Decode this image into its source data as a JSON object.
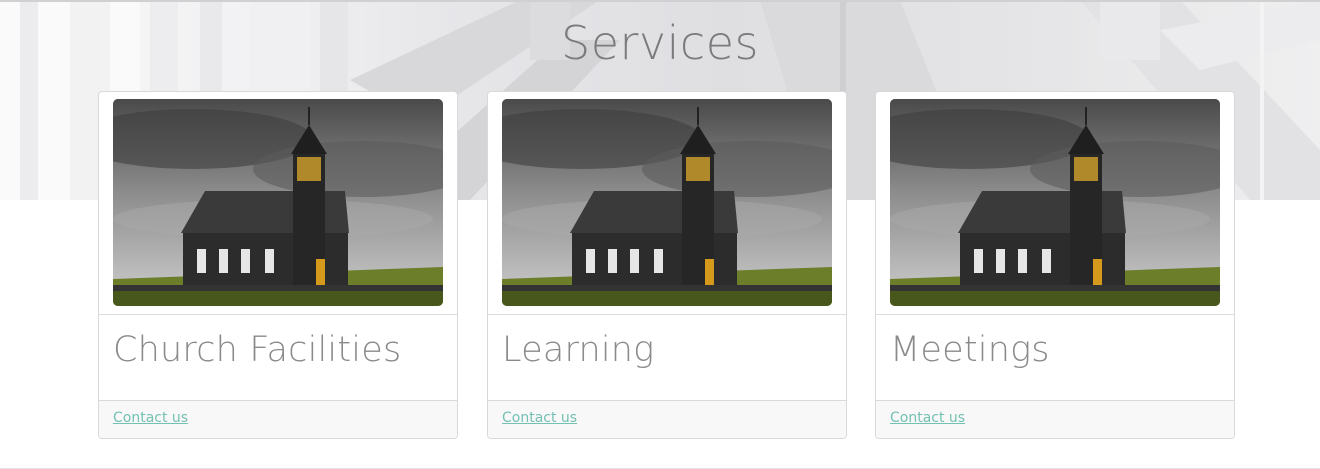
{
  "section": {
    "title": "Services"
  },
  "cards": [
    {
      "title": "Church Facilities",
      "link": "Contact us"
    },
    {
      "title": "Learning",
      "link": "Contact us"
    },
    {
      "title": "Meetings",
      "link": "Contact us"
    }
  ],
  "colors": {
    "title_text": "#7b7b7b",
    "card_title_text": "#8a8a8a",
    "link_text": "#74c0b3",
    "card_border": "#d9d9d9",
    "footer_bg": "#f8f8f8"
  }
}
